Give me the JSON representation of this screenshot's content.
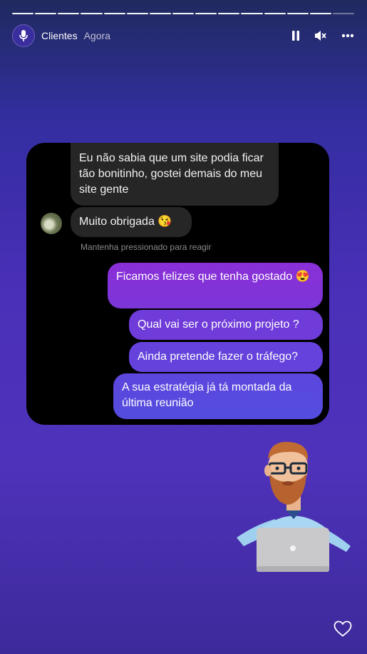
{
  "story": {
    "account_name": "Clientes",
    "time_ago": "Agora",
    "segments": 15,
    "active_segment": 15
  },
  "header_icons": [
    "pause-icon",
    "mute-icon",
    "more-icon"
  ],
  "chat": {
    "received": [
      "Eu não sabia que um site podia ficar tão bonitinho, gostei demais do meu site gente",
      "Muito obrigada 😘"
    ],
    "hint": "Mantenha pressionado para reagir",
    "sent": [
      "Ficamos felizes que tenha gostado 😍",
      "Qual vai ser o próximo projeto ?",
      "Ainda pretende fazer o tráfego?",
      "A sua estratégia já tá montada da última reunião"
    ]
  },
  "colors": {
    "sent_gradient_top": "#8a2fd8",
    "sent_gradient_bottom": "#5a4be0",
    "received_bubble": "#262626"
  }
}
